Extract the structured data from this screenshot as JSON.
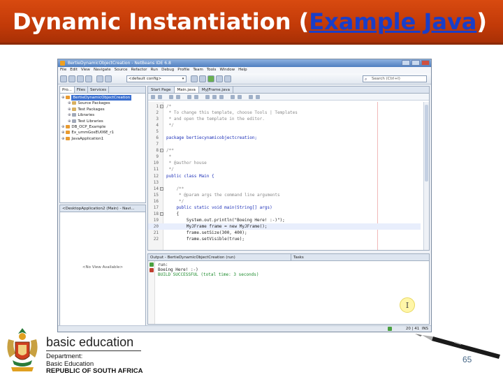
{
  "slide": {
    "title_prefix": "Dynamic Instantiation (",
    "title_link": "Example Java",
    "title_suffix": ")",
    "page_number": "65"
  },
  "ide": {
    "window_title": "BertieDynamicObjectCreation - NetBeans IDE 6.8",
    "menu": [
      "File",
      "Edit",
      "View",
      "Navigate",
      "Source",
      "Refactor",
      "Run",
      "Debug",
      "Profile",
      "Team",
      "Tools",
      "Window",
      "Help"
    ],
    "config_value": "<default config>",
    "search_placeholder": "Search (Ctrl+I)",
    "project_tabs": [
      "Pro...",
      "Files",
      "Services"
    ],
    "project_tree": [
      {
        "label": "BertieDynamicObjectCreation",
        "selected": true,
        "indent": 0,
        "icon": "cup"
      },
      {
        "label": "Source Packages",
        "indent": 1,
        "icon": "pkg"
      },
      {
        "label": "Test Packages",
        "indent": 1,
        "icon": "pkg"
      },
      {
        "label": "Libraries",
        "indent": 1,
        "icon": "jar"
      },
      {
        "label": "Test Libraries",
        "indent": 1,
        "icon": "jar"
      },
      {
        "label": "DB_OCP_Example",
        "indent": 0,
        "icon": "cup"
      },
      {
        "label": "Ex_ummGosEU06E_r1",
        "indent": 0,
        "icon": "cup"
      },
      {
        "label": "JavaApplication1",
        "indent": 0,
        "icon": "cup"
      }
    ],
    "navigator_title": "<DesktopApplication2 (Main) - Navi...",
    "navigator_empty": "<No View Available>",
    "editor_tabs": [
      "Start Page",
      "Main.java",
      "MyJFrame.java"
    ],
    "code_lines": [
      {
        "n": "1",
        "fold": true,
        "text": "/*",
        "cls": "c-com"
      },
      {
        "n": "2",
        "text": " * To change this template, choose Tools | Templates",
        "cls": "c-com"
      },
      {
        "n": "3",
        "text": " * and open the template in the editor.",
        "cls": "c-com"
      },
      {
        "n": "4",
        "text": " */",
        "cls": "c-com"
      },
      {
        "n": "5",
        "text": "",
        "cls": ""
      },
      {
        "n": "6",
        "text": "package bertiecynamicobjectcreation;",
        "cls": "c-kw"
      },
      {
        "n": "7",
        "text": "",
        "cls": ""
      },
      {
        "n": "8",
        "fold": true,
        "text": "/**",
        "cls": "c-com"
      },
      {
        "n": "9",
        "text": " *",
        "cls": "c-com"
      },
      {
        "n": "10",
        "text": " * @author house",
        "cls": "c-com"
      },
      {
        "n": "11",
        "text": " */",
        "cls": "c-com"
      },
      {
        "n": "12",
        "text": "public class Main {",
        "cls": "c-kw"
      },
      {
        "n": "13",
        "text": "",
        "cls": ""
      },
      {
        "n": "14",
        "fold": true,
        "text": "    /**",
        "cls": "c-com"
      },
      {
        "n": "15",
        "text": "     * @param args the command line arguments",
        "cls": "c-com"
      },
      {
        "n": "16",
        "text": "     */",
        "cls": "c-com"
      },
      {
        "n": "17",
        "text": "    public static void main(String[] args)",
        "cls": "c-kw"
      },
      {
        "n": "18",
        "fold": true,
        "text": "    {",
        "cls": ""
      },
      {
        "n": "19",
        "text": "        System.out.println(\"Boeing Here! :-)\");",
        "cls": ""
      },
      {
        "n": "20",
        "text": "        MyJFrame frame = new MyJFrame();",
        "cls": "",
        "hl": true
      },
      {
        "n": "21",
        "text": "        frame.setSize(300, 400);",
        "cls": ""
      },
      {
        "n": "22",
        "text": "        frame.setVisible(true);",
        "cls": ""
      }
    ],
    "output_title": "Output - BertieDynamicObjectCreation (run)",
    "tasks_title": "Tasks",
    "output_lines": [
      {
        "text": "run:",
        "cls": ""
      },
      {
        "text": "Boeing Here! :-)",
        "cls": ""
      },
      {
        "text": "BUILD SUCCESSFUL (total time: 3 seconds)",
        "cls": "green"
      }
    ],
    "cursor_glyph": "I",
    "status_position": "20 | 41",
    "status_mode": "INS"
  },
  "footer": {
    "brand": "basic education",
    "dept_lines": [
      "Department:",
      "Basic Education",
      "REPUBLIC OF SOUTH AFRICA"
    ]
  }
}
